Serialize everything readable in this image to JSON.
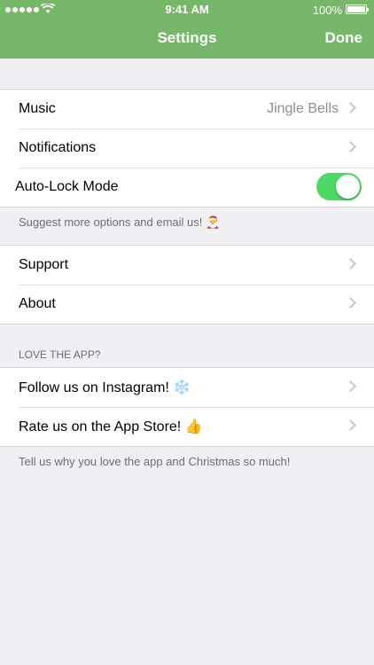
{
  "status_bar": {
    "time": "9:41 AM",
    "battery_percent": "100%",
    "signal_bars": 5,
    "icons": [
      "signal-icon",
      "wifi-icon",
      "battery-icon"
    ]
  },
  "nav": {
    "title": "Settings",
    "done_label": "Done",
    "accent_color": "#77b76a"
  },
  "group1": {
    "music_label": "Music",
    "music_value": "Jingle Bells",
    "notifications_label": "Notifications",
    "autolock_label": "Auto-Lock Mode",
    "autolock_on": true,
    "toggle_color": "#4cd964"
  },
  "group1_footer": "Suggest more options and email us! 🎅",
  "group2": {
    "support_label": "Support",
    "about_label": "About"
  },
  "group3_header": "LOVE THE APP?",
  "group3": {
    "instagram_label": "Follow us on Instagram! ❄️",
    "rate_label": "Rate us on the App Store! 👍"
  },
  "group3_footer": "Tell us why you love the app and Christmas so much!"
}
